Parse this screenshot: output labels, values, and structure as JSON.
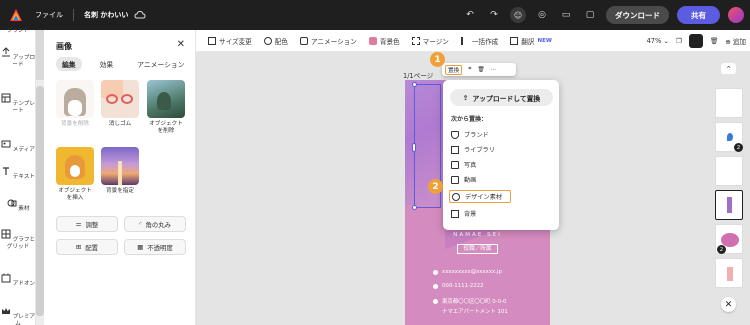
{
  "topbar": {
    "file_label": "ファイル",
    "doc_title": "名刺 かわいい",
    "download_label": "ダウンロード",
    "share_label": "共有"
  },
  "rail": {
    "items": [
      "アップロード",
      "テンプレート",
      "メディア",
      "テキスト",
      "素材",
      "グラフとグリッド",
      "アドオン",
      "プレミアム"
    ]
  },
  "panel": {
    "title": "画像",
    "tabs": [
      "編集",
      "効果",
      "アニメーション"
    ],
    "grid": [
      {
        "label": "背景を削除"
      },
      {
        "label": "消しゴム"
      },
      {
        "label": "オブジェクトを削除"
      },
      {
        "label": "オブジェクトを挿入"
      },
      {
        "label": "背景を指定"
      }
    ],
    "buttons": [
      "調整",
      "角の丸み",
      "配置",
      "不透明度"
    ]
  },
  "subbar": {
    "items": [
      "サイズ変更",
      "配色",
      "アニメーション",
      "背景色",
      "マージン",
      "一括作成",
      "翻訳"
    ],
    "new_badge": "NEW",
    "zoom": "47%",
    "add_label": "追加"
  },
  "canvas": {
    "page_label": "1/1ページ",
    "ctx_replace": "置換",
    "doc_text": {
      "name": "NAMAE SEI",
      "role": "役職／所属",
      "email": "xxxxxxxxx@xxxxxx.jp",
      "phone": "000-1111-2222",
      "addr1": "東京都〇〇区〇〇町 0-0-0",
      "addr2": "ナマエアパートメント 101"
    }
  },
  "menu": {
    "upload_label": "アップロードして置換",
    "header": "次から置換：",
    "items": [
      "ブランド",
      "ライブラリ",
      "写真",
      "動画",
      "デザイン素材",
      "背景"
    ]
  },
  "badges": [
    "1",
    "2"
  ],
  "right_panel": {
    "counts": [
      "2",
      "2"
    ]
  },
  "colors": {
    "accent": "#5c5ce0",
    "highlight": "#e9a040",
    "doc_bg": "#d48bbf"
  }
}
